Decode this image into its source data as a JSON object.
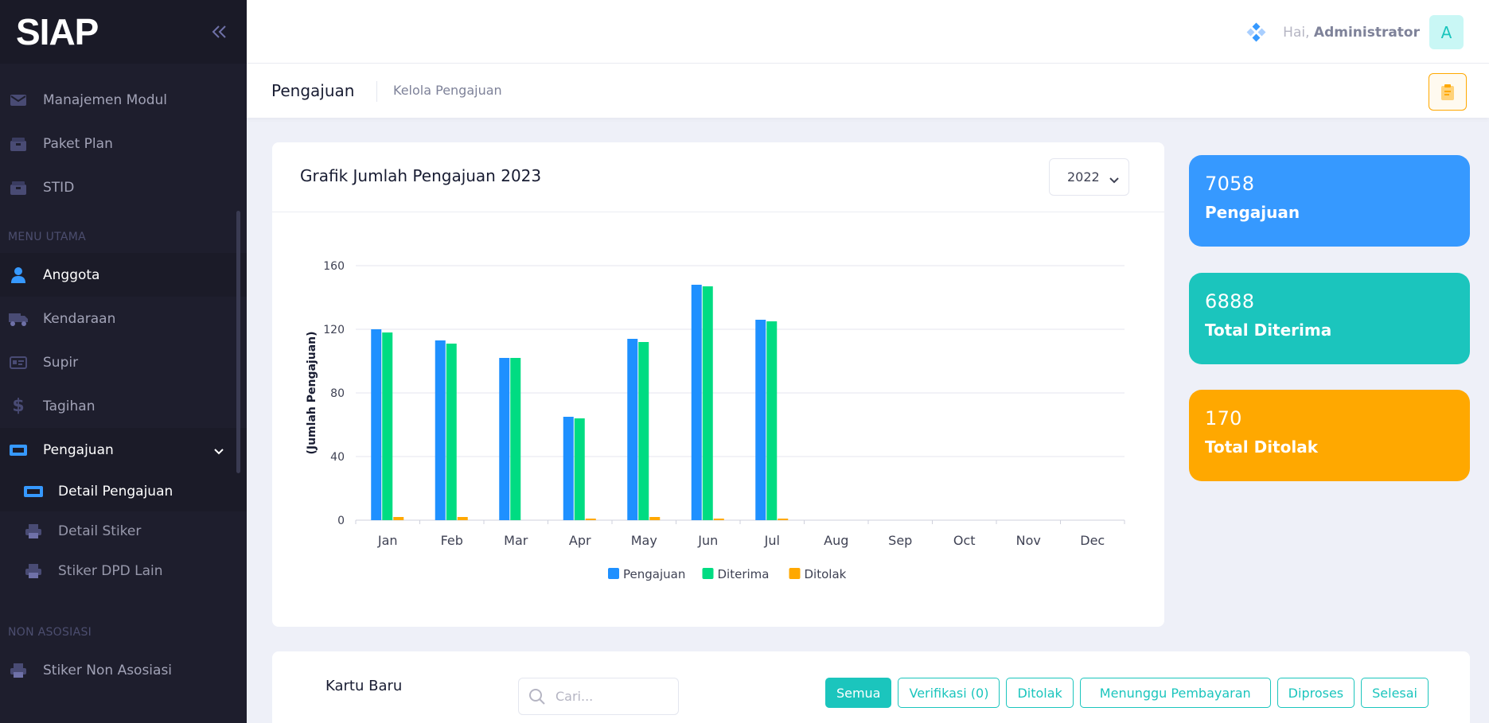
{
  "brand": {
    "logo": "SIAP"
  },
  "sidebar": {
    "top_items": [
      {
        "label": "Manajemen Modul",
        "icon": "envelope-icon"
      },
      {
        "label": "Paket Plan",
        "icon": "box-icon"
      },
      {
        "label": "STID",
        "icon": "box-icon"
      }
    ],
    "section_main": "MENU UTAMA",
    "main_items": [
      {
        "label": "Anggota",
        "icon": "user-icon"
      },
      {
        "label": "Kendaraan",
        "icon": "truck-icon"
      },
      {
        "label": "Supir",
        "icon": "id-card-icon"
      },
      {
        "label": "Tagihan",
        "icon": "dollar-icon"
      },
      {
        "label": "Pengajuan",
        "icon": "ticket-icon"
      }
    ],
    "sub_items": [
      {
        "label": "Detail Pengajuan",
        "icon": "ticket-icon"
      },
      {
        "label": "Detail Stiker",
        "icon": "printer-icon"
      },
      {
        "label": "Stiker DPD Lain",
        "icon": "printer-icon"
      }
    ],
    "section_non": "NON ASOSIASI",
    "non_items": [
      {
        "label": "Stiker Non Asosiasi",
        "icon": "printer-icon"
      }
    ]
  },
  "header": {
    "greeting": "Hai,",
    "username": "Administrator",
    "avatar_letter": "A"
  },
  "subheader": {
    "title": "Pengajuan",
    "description": "Kelola Pengajuan"
  },
  "chart_card": {
    "title": "Grafik Jumlah Pengajuan 2023",
    "year_selected": "2022"
  },
  "chart_data": {
    "type": "bar",
    "ylabel": "(Jumlah Pengajuan)",
    "ylim": [
      0,
      160
    ],
    "yticks": [
      0,
      40,
      80,
      120,
      160
    ],
    "grid": true,
    "legend_position": "bottom",
    "categories": [
      "Jan",
      "Feb",
      "Mar",
      "Apr",
      "May",
      "Jun",
      "Jul",
      "Aug",
      "Sep",
      "Oct",
      "Nov",
      "Dec"
    ],
    "series": [
      {
        "name": "Pengajuan",
        "color": "#1e90ff",
        "values": [
          120,
          113,
          102,
          65,
          114,
          148,
          126,
          0,
          0,
          0,
          0,
          0
        ]
      },
      {
        "name": "Diterima",
        "color": "#00dc82",
        "values": [
          118,
          111,
          102,
          64,
          112,
          147,
          125,
          0,
          0,
          0,
          0,
          0
        ]
      },
      {
        "name": "Ditolak",
        "color": "#ffa800",
        "values": [
          2,
          2,
          0,
          1,
          2,
          1,
          1,
          0,
          0,
          0,
          0,
          0
        ]
      }
    ]
  },
  "stats": [
    {
      "value": "7058",
      "label": "Pengajuan",
      "color": "#3699ff"
    },
    {
      "value": "6888",
      "label": "Total Diterima",
      "color": "#1bc5bd"
    },
    {
      "value": "170",
      "label": "Total Ditolak",
      "color": "#ffa800"
    }
  ],
  "table_card": {
    "title": "Kartu Baru",
    "search_placeholder": "Cari...",
    "filters": [
      "Semua",
      "Verifikasi (0)",
      "Ditolak",
      "Menunggu Pembayaran",
      "Diproses",
      "Selesai"
    ]
  }
}
